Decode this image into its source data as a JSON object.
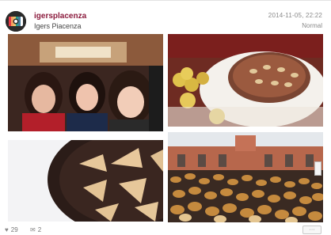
{
  "post": {
    "handle": "igersplacenza",
    "display_name": "Igers Piacenza",
    "timestamp": "2014-11-05, 22:22",
    "filter": "Normal",
    "likes": "29",
    "comments": "2",
    "more_label": "···"
  },
  "icons": {
    "avatar": "igers-logo-icon",
    "like": "heart-icon",
    "comment": "comment-icon"
  },
  "colors": {
    "handle": "#8b1b3d"
  }
}
